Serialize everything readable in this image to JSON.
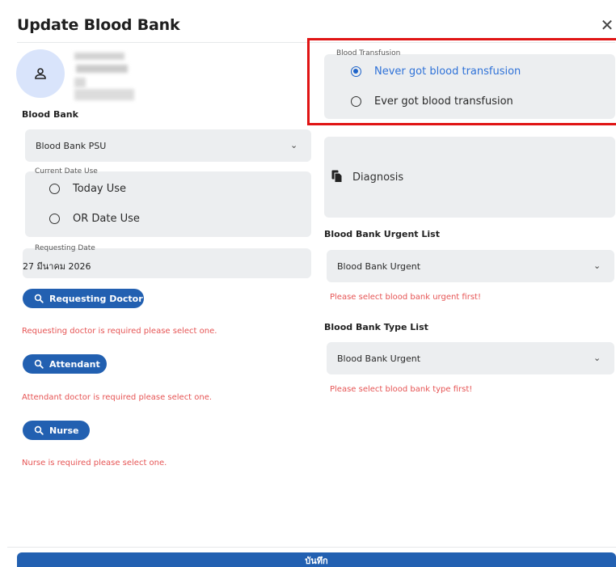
{
  "dialog": {
    "title": "Update Blood Bank",
    "close_icon": "close-icon"
  },
  "left": {
    "blood_bank_label": "Blood Bank",
    "blood_bank_select": "Blood Bank PSU",
    "current_date_use": {
      "legend": "Current Date Use",
      "options": [
        "Today Use",
        "OR Date Use"
      ],
      "selected": null
    },
    "requesting_date": {
      "legend": "Requesting Date",
      "value": "27 มีนาคม 2026"
    },
    "requesting_doctor_button": "Requesting Doctor",
    "requesting_doctor_error": "Requesting doctor is required please select one.",
    "attendant_button": "Attendant",
    "attendant_error": "Attendant doctor is required please select one.",
    "nurse_button": "Nurse",
    "nurse_error": "Nurse is required please select one."
  },
  "right": {
    "blood_transfusion": {
      "legend": "Blood Transfusion",
      "options": [
        "Never got blood transfusion",
        "Ever got blood transfusion"
      ],
      "selected": "Never got blood transfusion"
    },
    "diagnosis_label": "Diagnosis",
    "urgent_list_label": "Blood Bank Urgent List",
    "urgent_select": "Blood Bank Urgent",
    "urgent_error": "Please select blood bank urgent first!",
    "type_list_label": "Blood Bank Type List",
    "type_select": "Blood Bank Urgent",
    "type_error": "Please select blood bank type first!"
  },
  "footer": {
    "save_button": "บันทึก"
  },
  "colors": {
    "primary": "#2260b1",
    "error": "#e65454",
    "highlight": "#e01414",
    "field_bg": "#eceef0",
    "avatar_bg": "#d9e4fb"
  }
}
